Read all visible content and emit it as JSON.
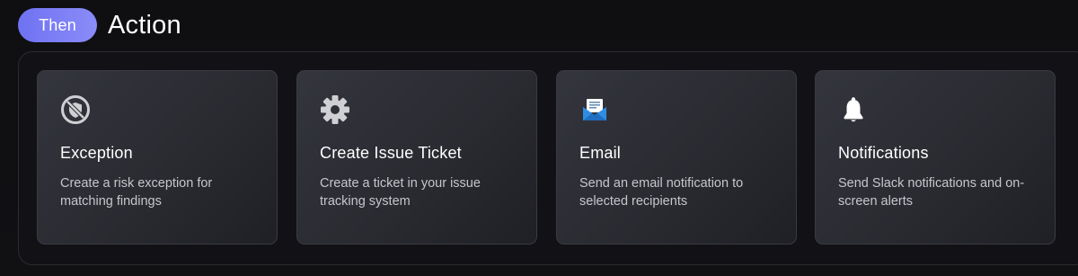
{
  "header": {
    "badge_label": "Then",
    "title": "Action"
  },
  "cards": [
    {
      "title": "Exception",
      "description": "Create a risk exception for matching findings",
      "icon": "shield-off-icon"
    },
    {
      "title": "Create Issue Ticket",
      "description": "Create a ticket in your issue tracking system",
      "icon": "gear-icon"
    },
    {
      "title": "Email",
      "description": "Send an email notification to selected recipients",
      "icon": "email-icon"
    },
    {
      "title": "Notifications",
      "description": "Send Slack notifications and on-screen alerts",
      "icon": "bell-icon"
    }
  ],
  "colors": {
    "badge": "#7b7df5",
    "email_icon_blue": "#2f8de4",
    "background": "#0f0f12"
  }
}
